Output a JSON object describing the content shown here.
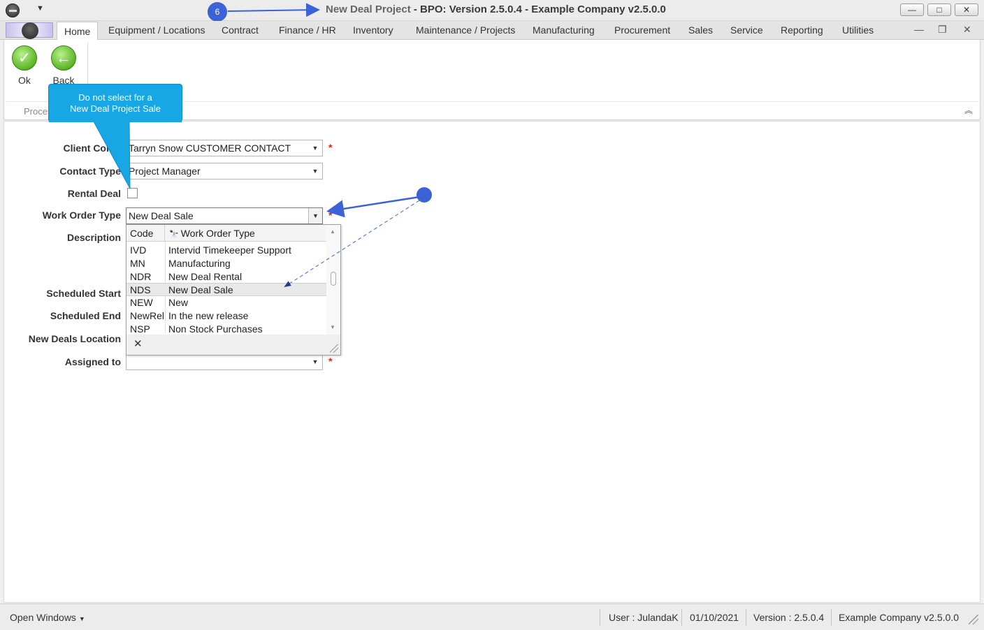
{
  "window": {
    "doc_title": "New Deal Project",
    "app_title": " - BPO: Version 2.5.0.4 - Example Company v2.5.0.0",
    "minimize": "—",
    "maximize": "□",
    "close": "✕"
  },
  "step_badge": "6",
  "tabs": [
    "Home",
    "Equipment / Locations",
    "Contract",
    "Finance / HR",
    "Inventory",
    "Maintenance / Projects",
    "Manufacturing",
    "Procurement",
    "Sales",
    "Service",
    "Reporting",
    "Utilities"
  ],
  "ribbon": {
    "ok_label": "Ok",
    "back_label": "Back",
    "group_label": "Proces"
  },
  "callout": {
    "line1": "Do not select for a",
    "line2": "New Deal Project Sale"
  },
  "form": {
    "client_contact_label": "Client Conta",
    "client_contact_value": "Tarryn Snow CUSTOMER CONTACT",
    "contact_type_label": "Contact Type",
    "contact_type_value": "Project Manager",
    "rental_deal_label": "Rental Deal",
    "rental_deal_checked": false,
    "work_order_type_label": "Work Order Type",
    "work_order_type_value": "New Deal Sale",
    "description_label": "Description",
    "scheduled_start_label": "Scheduled Start",
    "scheduled_end_label": "Scheduled End",
    "new_deals_location_label": "New Deals Location",
    "assigned_to_label": "Assigned to",
    "assigned_to_value": "",
    "required_marker": "*"
  },
  "dropdown": {
    "col_code": "Code",
    "col_type": "Work Order Type",
    "rows": [
      {
        "code": "IVD",
        "type": "Intervid Timekeeper Support"
      },
      {
        "code": "MN",
        "type": "Manufacturing"
      },
      {
        "code": "NDR",
        "type": "New Deal Rental"
      },
      {
        "code": "NDS",
        "type": "New Deal Sale"
      },
      {
        "code": "NEW",
        "type": "New"
      },
      {
        "code": "NewRel",
        "type": "In the new release"
      },
      {
        "code": "NSP",
        "type": "Non Stock Purchases"
      }
    ],
    "selected_index": 3
  },
  "statusbar": {
    "open_windows": "Open Windows",
    "user": "User : JulandaK",
    "date": "01/10/2021",
    "version": "Version : 2.5.0.4",
    "company": "Example Company v2.5.0.0"
  },
  "colors": {
    "callout": "#17a7e4",
    "annotation": "#3b63d7",
    "required": "#e02020"
  }
}
